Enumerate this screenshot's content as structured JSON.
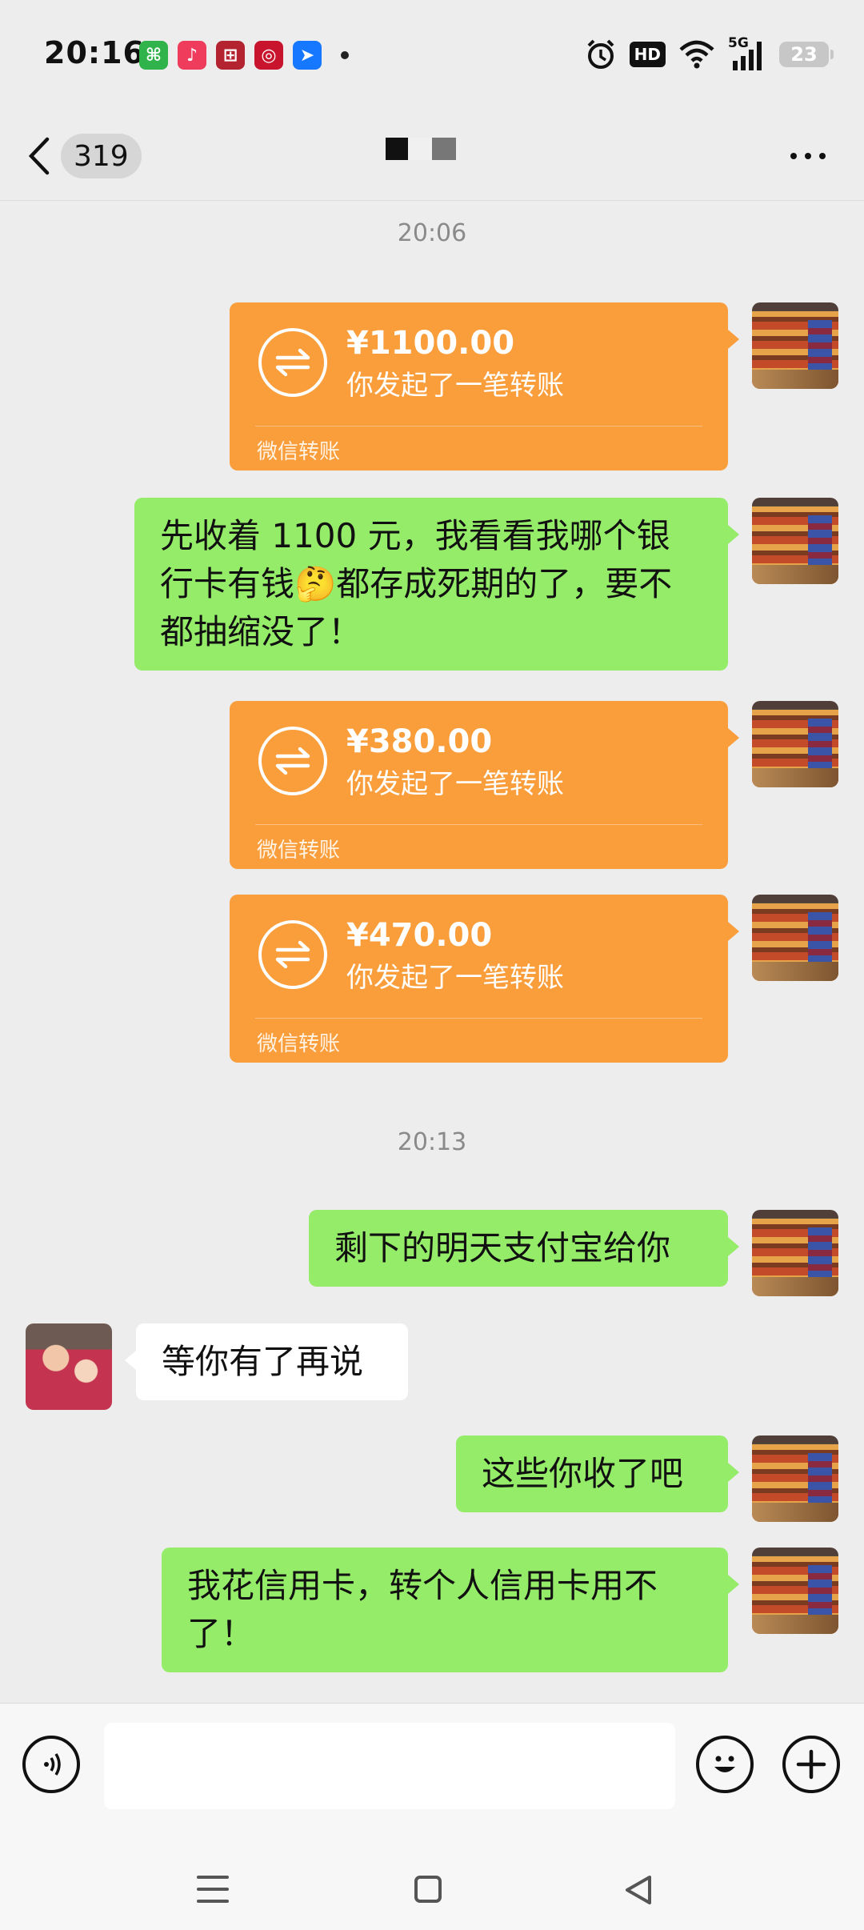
{
  "status_bar": {
    "time": "20:16",
    "hd": "HD",
    "network": "5G",
    "battery": "23"
  },
  "header": {
    "unread_count": "319",
    "contact_name": ""
  },
  "messages": [
    {
      "type": "timestamp",
      "text": "20:06"
    },
    {
      "type": "transfer",
      "side": "right",
      "amount": "¥1100.00",
      "desc": "你发起了一笔转账",
      "footer": "微信转账"
    },
    {
      "type": "text",
      "side": "right",
      "text": "先收着 1100 元，我看看我哪个银行卡有钱🤔都存成死期的了，要不都抽缩没了！"
    },
    {
      "type": "transfer",
      "side": "right",
      "amount": "¥380.00",
      "desc": "你发起了一笔转账",
      "footer": "微信转账"
    },
    {
      "type": "transfer",
      "side": "right",
      "amount": "¥470.00",
      "desc": "你发起了一笔转账",
      "footer": "微信转账"
    },
    {
      "type": "timestamp",
      "text": "20:13"
    },
    {
      "type": "text",
      "side": "right",
      "text": "剩下的明天支付宝给你"
    },
    {
      "type": "text",
      "side": "left",
      "text": "等你有了再说"
    },
    {
      "type": "text",
      "side": "right",
      "text": "这些你收了吧"
    },
    {
      "type": "text",
      "side": "right",
      "text": "我花信用卡，转个人信用卡用不了！"
    }
  ],
  "input": {
    "value": ""
  },
  "colors": {
    "bubble_self": "#95ec69",
    "bubble_other": "#ffffff",
    "transfer": "#fa9d3b",
    "background": "#ededed"
  }
}
